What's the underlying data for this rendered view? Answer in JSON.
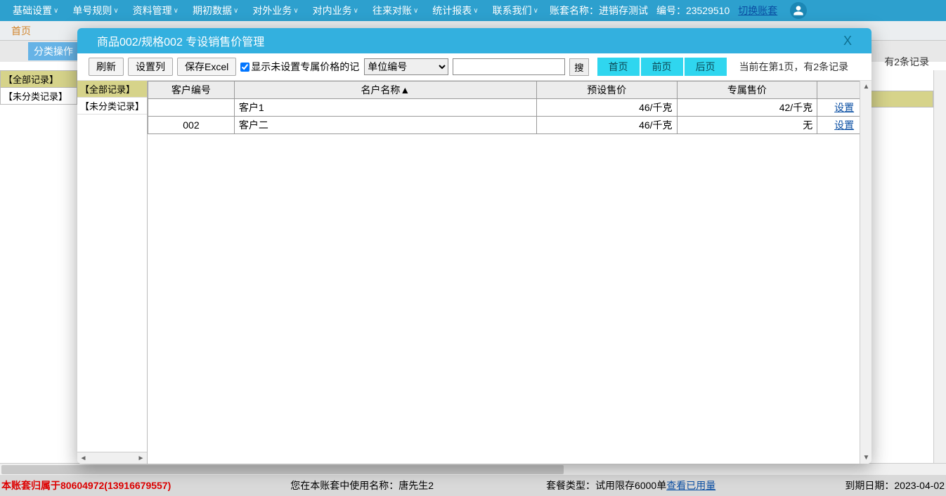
{
  "topmenu": [
    "基础设置",
    "单号规则",
    "资料管理",
    "期初数据",
    "对外业务",
    "对内业务",
    "往来对账",
    "统计报表",
    "联系我们"
  ],
  "top_right": {
    "acct_label": "账套名称：",
    "acct_name": "进销存测试",
    "id_label": "编号：",
    "id_value": "23529510",
    "switch": "切换账套"
  },
  "tab_home": "首页",
  "bg": {
    "class_btn": "分类操作",
    "summary": "有2条记录",
    "side": [
      "【全部记录】",
      "【未分类记录】"
    ]
  },
  "modal": {
    "title": "商品002/规格002 专设销售价管理",
    "close": "X",
    "toolbar": {
      "refresh": "刷新",
      "set_cols": "设置列",
      "save_excel": "保存Excel",
      "show_unset": "显示未设置专属价格的记录",
      "select_opt": "单位编号",
      "search_btn": "搜",
      "nav_first": "首页",
      "nav_prev": "前页",
      "nav_next": "后页",
      "page_info": "当前在第1页，有2条记录"
    },
    "side": [
      "【全部记录】",
      "【未分类记录】"
    ],
    "headers": {
      "code": "客户编号",
      "name": "名户名称▲",
      "preset": "预设售价",
      "excl": "专属售价",
      "act": ""
    },
    "rows": [
      {
        "code": "",
        "name": "客户1",
        "preset": "46/千克",
        "excl": "42/千克",
        "act": "设置"
      },
      {
        "code": "002",
        "name": "客户二",
        "preset": "46/千克",
        "excl": "无",
        "act": "设置"
      }
    ]
  },
  "footer": {
    "owner": "本账套归属于80604972(13916679557)",
    "user_label": "您在本账套中使用名称：",
    "user_name": "唐先生2",
    "pkg_label": "套餐类型：",
    "pkg_value": "试用限存6000单",
    "usage_link": "查看已用量",
    "expire_label": "到期日期：",
    "expire_value": "2023-04-02"
  }
}
